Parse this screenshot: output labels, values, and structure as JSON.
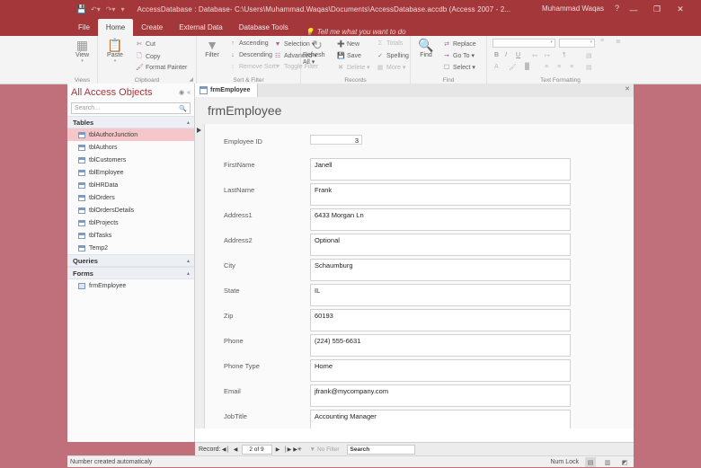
{
  "titlebar": {
    "save_icon": "save-icon",
    "undo_icon": "undo-icon",
    "redo_icon": "redo-icon",
    "customize_icon": "customize-qat-icon",
    "title": "AccessDatabase : Database- C:\\Users\\Muhammad.Waqas\\Documents\\AccessDatabase.accdb (Access 2007 - 2...",
    "user": "Muhammad Waqas",
    "help": "?",
    "minimize": "—",
    "restore": "❐",
    "close": "✕"
  },
  "ribbon": {
    "tabs": [
      {
        "label": "File",
        "active": false
      },
      {
        "label": "Home",
        "active": true
      },
      {
        "label": "Create",
        "active": false
      },
      {
        "label": "External Data",
        "active": false
      },
      {
        "label": "Database Tools",
        "active": false
      }
    ],
    "tellme": "Tell me what you want to do",
    "groups": {
      "views": {
        "label": "Views",
        "button": "View",
        "caret": "▾"
      },
      "clipboard": {
        "label": "Clipboard",
        "paste": "Paste",
        "cut": "Cut",
        "copy": "Copy",
        "format_painter": "Format Painter"
      },
      "sort_filter": {
        "label": "Sort & Filter",
        "filter": "Filter",
        "ascending": "Ascending",
        "descending": "Descending",
        "remove_sort": "Remove Sort",
        "selection": "Selection ▾",
        "advanced": "Advanced ▾",
        "toggle_filter": "Toggle Filter"
      },
      "records": {
        "label": "Records",
        "refresh_all": "Refresh All ▾",
        "new": "New",
        "save": "Save",
        "delete": "Delete  ▾",
        "totals": "Totals",
        "spelling": "Spelling",
        "more": "More ▾"
      },
      "find": {
        "label": "Find",
        "find": "Find",
        "replace": "Replace",
        "goto": "Go To ▾",
        "select": "Select ▾"
      },
      "text_formatting": {
        "label": "Text Formatting",
        "font_name": "",
        "font_size": "",
        "bold": "B",
        "italic": "I",
        "underline": "U"
      }
    }
  },
  "navpane": {
    "title": "All Access Objects",
    "menu_icon": "nav-options-icon",
    "collapse_icon": "collapse-pane-icon",
    "search_placeholder": "Search...",
    "search_icon": "search-icon",
    "groups": [
      {
        "name": "Tables",
        "items": [
          {
            "label": "tblAuthorJunction",
            "selected": true,
            "type": "table"
          },
          {
            "label": "tblAuthors",
            "selected": false,
            "type": "table"
          },
          {
            "label": "tblCustomers",
            "selected": false,
            "type": "table"
          },
          {
            "label": "tblEmployee",
            "selected": false,
            "type": "table"
          },
          {
            "label": "tblHRData",
            "selected": false,
            "type": "table"
          },
          {
            "label": "tblOrders",
            "selected": false,
            "type": "table"
          },
          {
            "label": "tblOrdersDetails",
            "selected": false,
            "type": "table"
          },
          {
            "label": "tblProjects",
            "selected": false,
            "type": "table"
          },
          {
            "label": "tblTasks",
            "selected": false,
            "type": "table"
          },
          {
            "label": "Temp2",
            "selected": false,
            "type": "table"
          }
        ]
      },
      {
        "name": "Queries",
        "items": []
      },
      {
        "name": "Forms",
        "items": [
          {
            "label": "frmEmployee",
            "selected": false,
            "type": "form"
          }
        ]
      }
    ]
  },
  "document": {
    "tab_label": "frmEmployee",
    "close_icon": "close-icon",
    "form_title": "frmEmployee",
    "fields": [
      {
        "label": "Employee ID",
        "value": "3",
        "size": "small"
      },
      {
        "label": "FirstName",
        "value": "Janell",
        "size": "wide"
      },
      {
        "label": "LastName",
        "value": "Frank",
        "size": "wide"
      },
      {
        "label": "Address1",
        "value": "6433 Morgan Ln",
        "size": "wide"
      },
      {
        "label": "Address2",
        "value": "Optional",
        "size": "wide"
      },
      {
        "label": "City",
        "value": "Schaumburg",
        "size": "wide"
      },
      {
        "label": "State",
        "value": "IL",
        "size": "wide"
      },
      {
        "label": "Zip",
        "value": "60193",
        "size": "wide"
      },
      {
        "label": "Phone",
        "value": "(224) 555-6631",
        "size": "wide"
      },
      {
        "label": "Phone Type",
        "value": "Home",
        "size": "wide"
      },
      {
        "label": "Email",
        "value": "jfrank@mycompany.com",
        "size": "wide"
      },
      {
        "label": "JobTitle",
        "value": "Accounting Manager",
        "size": "wide"
      }
    ]
  },
  "recordnav": {
    "label": "Record:",
    "first": "◀│",
    "prev": "◀",
    "position": "2 of 9",
    "next": "▶",
    "last": "│▶",
    "new_record": "▶✳",
    "filter_icon": "filter-icon",
    "filter_label": "No Filter",
    "search_label": "Search"
  },
  "statusbar": {
    "message": "Number created automaticaly",
    "num_lock": "Num Lock",
    "views": [
      {
        "name": "form-view-icon",
        "glyph": "▤",
        "active": true
      },
      {
        "name": "layout-view-icon",
        "glyph": "▥",
        "active": false
      },
      {
        "name": "design-view-icon",
        "glyph": "◩",
        "active": false
      }
    ]
  },
  "colors": {
    "accent": "#a4373a",
    "window_frame": "#c0707a",
    "selection": "#f5c6ca"
  }
}
